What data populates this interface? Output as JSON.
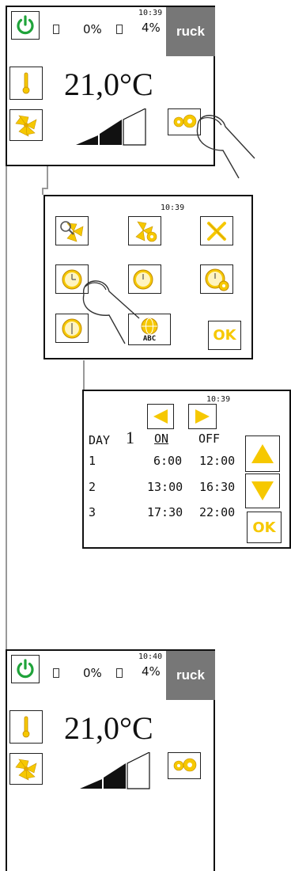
{
  "screen1": {
    "time": "10:39",
    "filter1_percent": "0%",
    "filter2_percent": "4%",
    "temperature": "21,0°C",
    "logo": "ruck",
    "fan_level": 2,
    "fan_level_max": 3
  },
  "screen2": {
    "time": "10:39",
    "icons": [
      "search-fan-icon",
      "fan-settings-icon",
      "tools-icon",
      "clock-icon",
      "clock-moon-icon",
      "clock-gear-icon",
      "clock-icon",
      "globe-abc-icon"
    ],
    "ok_label": "OK",
    "abc_label": "ABC"
  },
  "screen3": {
    "time": "10:39",
    "day_label": "DAY",
    "day_number": "1",
    "on_header": "ON",
    "off_header": "OFF",
    "rows": [
      {
        "index": "1",
        "on": "6:00",
        "off": "12:00"
      },
      {
        "index": "2",
        "on": "13:00",
        "off": "16:30"
      },
      {
        "index": "3",
        "on": "17:30",
        "off": "22:00"
      }
    ],
    "ok_label": "OK"
  },
  "screen4": {
    "time": "10:40",
    "filter1_percent": "0%",
    "filter2_percent": "4%",
    "temperature": "21,0°C",
    "logo": "ruck",
    "fan_level": 2,
    "fan_level_max": 3
  },
  "colors": {
    "power_green": "#1fa33a",
    "accent_yellow": "#f6c800",
    "logo_gray": "#777777",
    "frame": "#111111"
  }
}
